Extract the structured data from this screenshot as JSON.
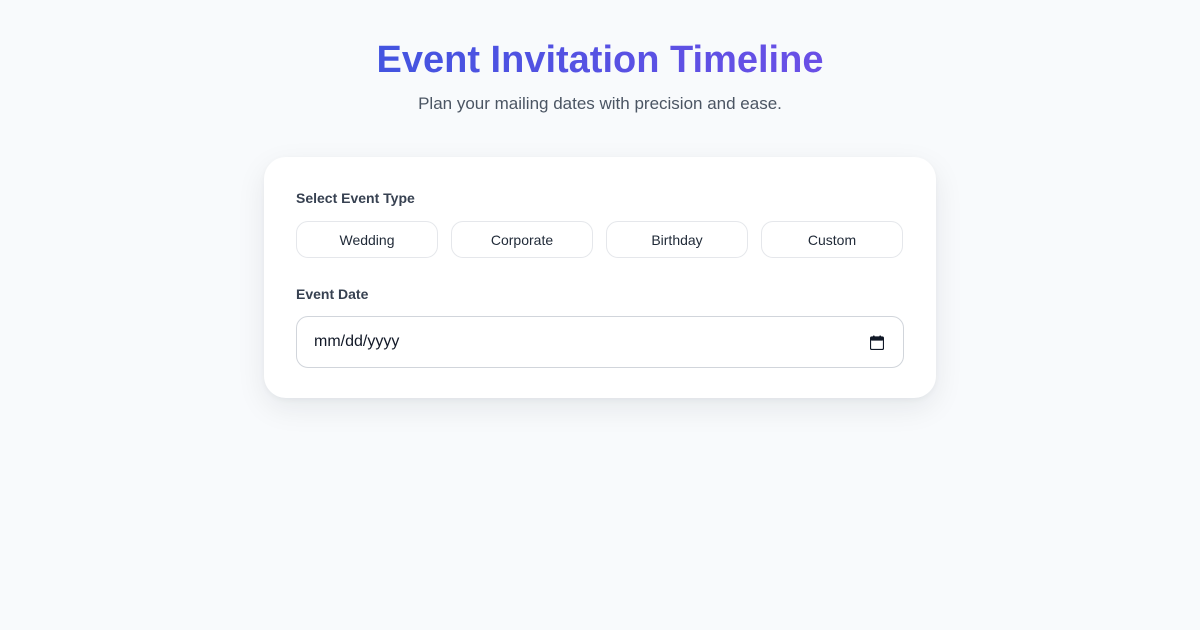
{
  "header": {
    "title": "Event Invitation Timeline",
    "subtitle": "Plan your mailing dates with precision and ease."
  },
  "form": {
    "event_type_label": "Select Event Type",
    "event_types": [
      "Wedding",
      "Corporate",
      "Birthday",
      "Custom"
    ],
    "event_date_label": "Event Date",
    "event_date_value": "",
    "event_date_placeholder": "mm/dd/yyyy"
  },
  "icons": {
    "date_picker": "calendar-icon"
  },
  "colors": {
    "background": "#f8fafc",
    "title_gradient_start": "#4354e0",
    "title_gradient_end": "#6a4fe6",
    "card": "#ffffff"
  }
}
